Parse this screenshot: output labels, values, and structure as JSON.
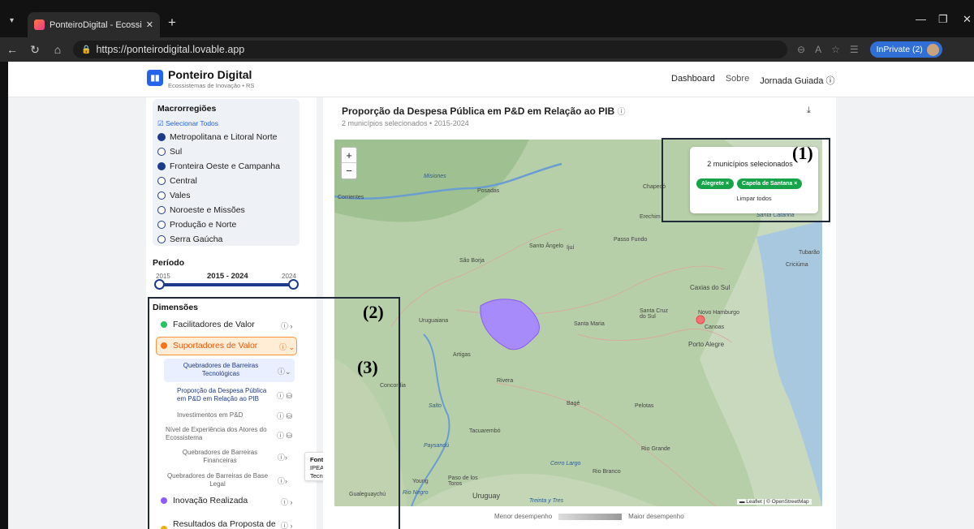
{
  "browser": {
    "tab_title": "PonteiroDigital - Ecossistemas Reg",
    "url": "https://ponteirodigital.lovable.app",
    "inprivate_label": "InPrivate (2)"
  },
  "header": {
    "brand_title": "Ponteiro Digital",
    "brand_subtitle": "Ecossistemas de Inovação • RS",
    "nav": [
      "Dashboard",
      "Sobre",
      "Jornada Guiada"
    ]
  },
  "sidebar": {
    "macro_title": "Macrorregiões",
    "select_all": "Selecionar Todos",
    "regions": [
      {
        "label": "Metropolitana e Litoral Norte",
        "checked": true
      },
      {
        "label": "Sul",
        "checked": false
      },
      {
        "label": "Fronteira Oeste e Campanha",
        "checked": true
      },
      {
        "label": "Central",
        "checked": false
      },
      {
        "label": "Vales",
        "checked": false
      },
      {
        "label": "Noroeste e Missões",
        "checked": false
      },
      {
        "label": "Produção e Norte",
        "checked": false
      },
      {
        "label": "Serra Gaúcha",
        "checked": false
      }
    ],
    "period_title": "Período",
    "period_min": "2015",
    "period_max": "2024",
    "period_range": "2015 - 2024",
    "period_selected": [
      2015,
      2024
    ],
    "dimensions_title": "Dimensões",
    "dimensions": [
      {
        "label": "Facilitadores de Valor",
        "color": "#22c55e"
      },
      {
        "label": "Suportadores de Valor",
        "color": "#f97316"
      },
      {
        "label": "Inovação Realizada",
        "color": "#8b5cf6"
      },
      {
        "label": "Resultados da Proposta de",
        "color": "#eab308"
      }
    ],
    "sub_group": "Quebradores de Barreiras Tecnológicas",
    "indicators": [
      "Proporção da Despesa Pública em P&D em Relação ao PIB",
      "Investimentos em P&D",
      "Nível de Experiência dos Atores do Ecossistema"
    ],
    "sub_groups_more": [
      "Quebradores de Barreiras Financeiras",
      "Quebradores de Barreiras de Base Legal"
    ]
  },
  "tooltip": {
    "title": "Fonte de Dados:",
    "text": "IPEA (Ciência e Tecnologia)"
  },
  "main": {
    "title": "Proporção da Despesa Pública em P&D em Relação ao PIB",
    "subtitle": "2 municípios selecionados • 2015-2024",
    "selector_label": "2 municípios selecionados",
    "chips": [
      "Alegrete ×",
      "Capela de Santana ×"
    ],
    "clear_all": "Limpar todos",
    "attribution": "▬ Leaflet | © OpenStreetMap",
    "legend_low": "Menor desempenho",
    "legend_high": "Maior desempenho"
  },
  "map_labels": [
    "Corrientes",
    "Posadas",
    "Misiones",
    "Chapecó",
    "Erechim",
    "Passo Fundo",
    "Santo Ângelo",
    "Ijuí",
    "São Borja",
    "Tubarão",
    "Criciúma",
    "Caxias do Sul",
    "Santa Cruz do Sul",
    "Novo Hamburgo",
    "Canoas",
    "Porto Alegre",
    "Santa Maria",
    "Uruguaiana",
    "Artigas",
    "Rivera",
    "Bagé",
    "Pelotas",
    "Rio Grande",
    "Tacuarembó",
    "Paysandú",
    "Salto",
    "Cerro Largo",
    "Uruguay",
    "Gualeguaychú",
    "Concordia",
    "Santa Catarina",
    "Rio Branco",
    "Paso de los Toros",
    "Treinta y Tres",
    "Rio Negro",
    "Young"
  ],
  "annotations": [
    "(1)",
    "(2)",
    "(3)"
  ]
}
